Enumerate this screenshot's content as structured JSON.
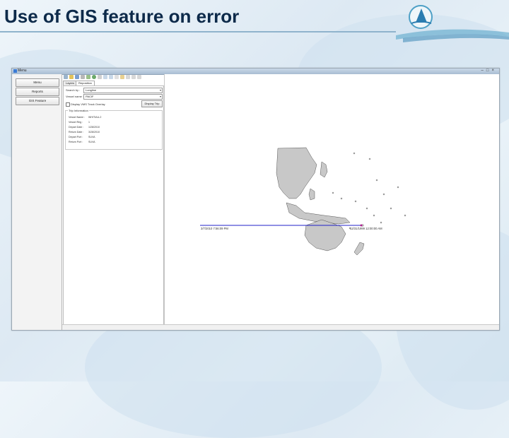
{
  "slide": {
    "title": "Use of GIS feature on error"
  },
  "app": {
    "window_title": "Menu",
    "left_buttons": [
      {
        "label": "Menu"
      },
      {
        "label": "Reports"
      },
      {
        "label": "GIS Feature"
      }
    ],
    "tabs": [
      {
        "label": "Layers"
      },
      {
        "label": "Reposition"
      }
    ],
    "form": {
      "search_by_label": "Search by :",
      "search_by_value": "Longline",
      "vessel_label": "Vessel name :",
      "vessel_value": "PACIF",
      "checkbox_label": "Display VMS Track Overlay",
      "display_button": "Display Trip"
    },
    "trip_info": {
      "title": "Trip Information",
      "rows": [
        {
          "label": "Vessel Name :",
          "value": "WHITIAU-2"
        },
        {
          "label": "Vessel Reg :",
          "value": "1"
        },
        {
          "label": "Depart Date :",
          "value": "1/28/2010"
        },
        {
          "label": "Return Date :",
          "value": "3/28/2010"
        },
        {
          "label": "Depart Port :",
          "value": "SUVA"
        },
        {
          "label": "Return Port :",
          "value": "SUVA"
        }
      ]
    },
    "map": {
      "track_start_label": "3/7/2010 7:56:09 PM",
      "track_end_label": "12/31/1999 12:00:00 AM",
      "track_color": "#2020c8",
      "land_color": "#c8c8c8"
    }
  }
}
